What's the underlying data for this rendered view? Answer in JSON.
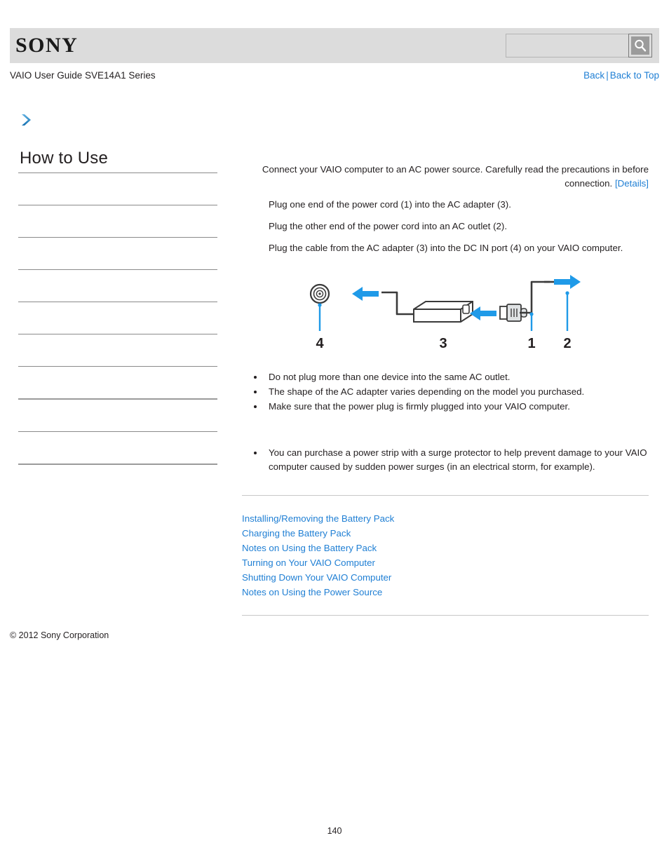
{
  "header": {
    "logo_text": "SONY",
    "search_placeholder": "",
    "search_value": "",
    "search_icon": "search-icon"
  },
  "sub_header": {
    "guide_title": "VAIO User Guide SVE14A1 Series",
    "back_label": "Back",
    "separator": "|",
    "back_to_top_label": "Back to Top"
  },
  "sidebar": {
    "chevron_icon": "chevron-right-icon",
    "section_title": "How to Use",
    "items": [
      {
        "label": ""
      },
      {
        "label": ""
      },
      {
        "label": ""
      },
      {
        "label": ""
      },
      {
        "label": ""
      },
      {
        "label": ""
      },
      {
        "label": ""
      },
      {
        "label": ""
      },
      {
        "label": ""
      },
      {
        "label": ""
      }
    ]
  },
  "main": {
    "intro_text": "Connect your VAIO computer to an AC power source. Carefully read the precautions in before connection.",
    "details_label": "[Details]",
    "steps": [
      "Plug one end of the power cord (1) into the AC adapter (3).",
      "Plug the other end of the power cord into an AC outlet (2).",
      "Plug the cable from the AC adapter (3) into the DC IN port (4) on your VAIO computer."
    ],
    "diagram": {
      "labels": [
        "1",
        "2",
        "3",
        "4"
      ],
      "parts": {
        "1": "power-cord-connector",
        "2": "ac-outlet-plug",
        "3": "ac-adapter",
        "4": "dc-in-port"
      },
      "accent_color": "#1f9ae8"
    },
    "notes_group_one": [
      "Do not plug more than one device into the same AC outlet.",
      "The shape of the AC adapter varies depending on the model you purchased.",
      "Make sure that the power plug is firmly plugged into your VAIO computer."
    ],
    "notes_group_two": [
      "You can purchase a power strip with a surge protector to help prevent damage to your VAIO computer caused by sudden power surges (in an electrical storm, for example)."
    ],
    "related_links": [
      "Installing/Removing the Battery Pack",
      "Charging the Battery Pack",
      "Notes on Using the Battery Pack",
      "Turning on Your VAIO Computer",
      "Shutting Down Your VAIO Computer",
      "Notes on Using the Power Source"
    ]
  },
  "footer": {
    "copyright": "© 2012 Sony Corporation",
    "page_number": "140"
  },
  "colors": {
    "link": "#1f7fd4",
    "header_band": "#dcdcdc",
    "accent": "#1f9ae8"
  }
}
